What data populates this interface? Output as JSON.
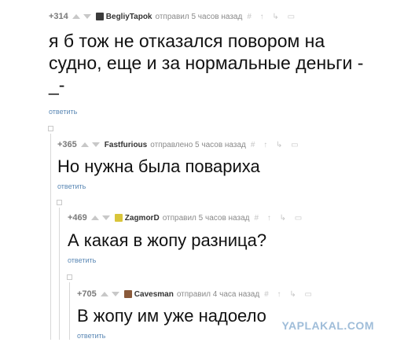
{
  "comments": [
    {
      "score": "+314",
      "user": "BegliyTapok",
      "time": "отправил 5 часов назад",
      "text": "я б тож не отказался повором на судно, еще и за нормальные деньги -_-",
      "reply": "ответить",
      "avatar_color": "#3b3b3b"
    },
    {
      "score": "+365",
      "user": "Fastfurious",
      "time": "отправлено 5 часов назад",
      "text": "Но нужна была повариха",
      "reply": "ответить",
      "avatar_color": ""
    },
    {
      "score": "+469",
      "user": "ZagmorD",
      "time": "отправил 5 часов назад",
      "text": "А какая в жопу разница?",
      "reply": "ответить",
      "avatar_color": "#d9c53a"
    },
    {
      "score": "+705",
      "user": "Cavesman",
      "time": "отправил 4 часа назад",
      "text": "В жопу им уже надоело",
      "reply": "ответить",
      "avatar_color": "#8a5a3a"
    }
  ],
  "tools": "# ↑ ↳ ▭",
  "watermark": "YAPLAKAL.COM"
}
